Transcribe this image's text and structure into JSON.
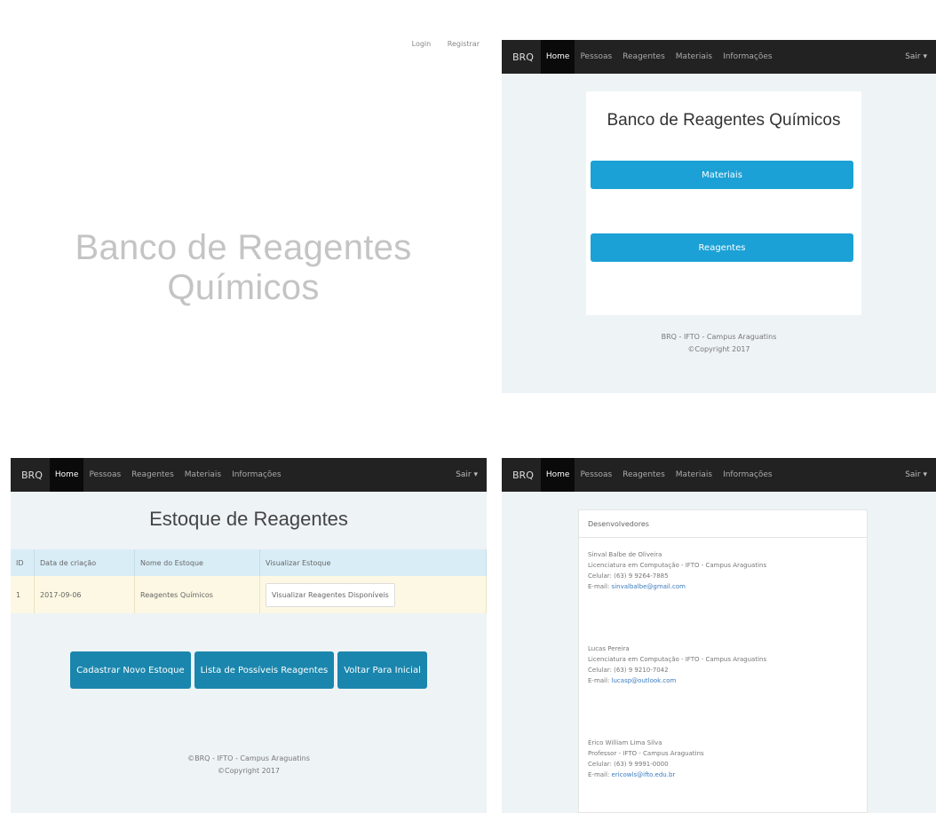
{
  "panel1": {
    "links": [
      "Login",
      "Registrar"
    ],
    "title": "Banco de Reagentes Químicos"
  },
  "nav": {
    "brand": "BRQ",
    "items": [
      "Home",
      "Pessoas",
      "Reagentes",
      "Materiais",
      "Informações"
    ],
    "right": "Sair ▾"
  },
  "panel2": {
    "title": "Banco de Reagentes Químicos",
    "buttons": [
      "Materiais",
      "Reagentes"
    ],
    "footer": [
      "BRQ - IFTO - Campus Araguatins",
      "©Copyright 2017"
    ]
  },
  "panel3": {
    "title": "Estoque de Reagentes",
    "headers": [
      "ID",
      "Data de criação",
      "Nome do Estoque",
      "Visualizar Estoque"
    ],
    "row": [
      "1",
      "2017-09-06",
      "Reagentes Químicos",
      "Visualizar Reagentes Disponíveis"
    ],
    "actions": [
      "Cadastrar Novo Estoque",
      "Lista de Possíveis Reagentes",
      "Voltar Para Inicial"
    ],
    "footer": [
      "©BRQ - IFTO - Campus Araguatins",
      "©Copyright 2017"
    ]
  },
  "panel4": {
    "card_title": "Desenvolvedores",
    "people": [
      {
        "name": "Sinval Balbe de Oliveira",
        "line1": "Licenciatura em Computação - IFTO - Campus Araguatins",
        "line2": "Celular: (63) 9 9264-7885",
        "email_label": "E-mail:",
        "email": "sinvalbalbe@gmail.com"
      },
      {
        "name": "Lucas Pereira",
        "line1": "Licenciatura em Computação - IFTO - Campus Araguatins",
        "line2": "Celular: (63) 9 9210-7042",
        "email_label": "E-mail:",
        "email": "lucasp@outlook.com"
      },
      {
        "name": "Érico William Lima Silva",
        "line1": "Professor - IFTO - Campus Araguatins",
        "line2": "Celular: (63) 9 9991-0000",
        "email_label": "E-mail:",
        "email": "ericowls@ifto.edu.br"
      }
    ]
  }
}
